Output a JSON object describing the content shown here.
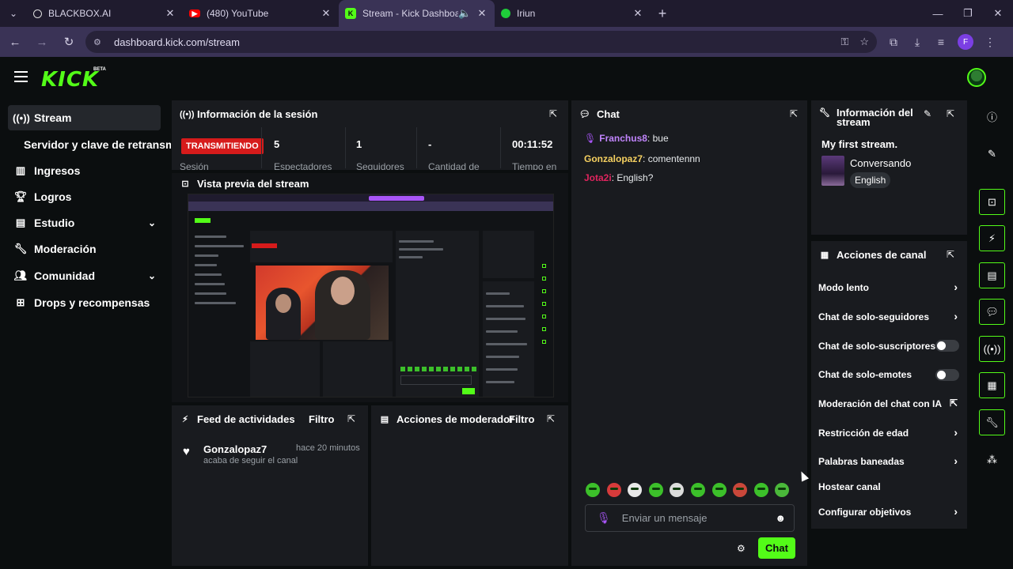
{
  "browser": {
    "tabs": [
      {
        "title": "BLACKBOX.AI",
        "favicon": "blackbox-icon"
      },
      {
        "title": "(480) YouTube",
        "favicon": "youtube-icon"
      },
      {
        "title": "Stream - Kick Dashboard",
        "favicon": "kick-icon"
      },
      {
        "title": "Iriun",
        "favicon": "iriun-icon"
      }
    ],
    "url": "dashboard.kick.com/stream",
    "profile_letter": "F"
  },
  "app": {
    "logo": "KICK",
    "logo_badge": "BETA"
  },
  "sidebar": {
    "items": [
      {
        "label": "Stream",
        "icon": "broadcast-icon"
      },
      {
        "label": "Servidor y clave de retransm"
      },
      {
        "label": "Ingresos",
        "icon": "chart-icon"
      },
      {
        "label": "Logros",
        "icon": "trophy-icon"
      },
      {
        "label": "Estudio",
        "icon": "studio-icon"
      },
      {
        "label": "Moderación",
        "icon": "wrench-icon"
      },
      {
        "label": "Comunidad",
        "icon": "users-icon"
      },
      {
        "label": "Drops y recompensas",
        "icon": "drops-icon"
      }
    ]
  },
  "session": {
    "title": "Información de la sesión",
    "status": "TRANSMITIENDO",
    "status_label": "Sesión",
    "stats": [
      {
        "value": "5",
        "label": "Espectadores"
      },
      {
        "value": "1",
        "label": "Seguidores"
      },
      {
        "value": "-",
        "label": "Cantidad de"
      },
      {
        "value": "00:11:52",
        "label": "Tiempo en"
      }
    ]
  },
  "preview": {
    "title": "Vista previa del stream"
  },
  "feed": {
    "title": "Feed de actividades",
    "filter": "Filtro",
    "items": [
      {
        "user": "Gonzalopaz7",
        "time": "hace 20 minutos",
        "action": "acaba de seguir el canal"
      }
    ]
  },
  "modactions": {
    "title": "Acciones de moderador",
    "filter": "Filtro"
  },
  "chat": {
    "title": "Chat",
    "messages": [
      {
        "user": "Franchus8",
        "text": "bue",
        "color": "#c084fc"
      },
      {
        "user": "Gonzalopaz7",
        "text": "comentennn",
        "color": "#f5d060"
      },
      {
        "user": "Jota2i",
        "text": "English?",
        "color": "#e0245e"
      }
    ],
    "input_placeholder": "Enviar un mensaje",
    "send_label": "Chat",
    "emote_count": 10
  },
  "stream_info": {
    "title": "Información del stream",
    "stream_title": "My first stream.",
    "category": "Conversando",
    "tag": "English"
  },
  "channel_actions": {
    "title": "Acciones de canal",
    "items": [
      {
        "label": "Modo lento",
        "control": "chevron"
      },
      {
        "label": "Chat de solo-seguidores",
        "control": "chevron"
      },
      {
        "label": "Chat de solo-suscriptores",
        "control": "toggle",
        "on": false
      },
      {
        "label": "Chat de solo-emotes",
        "control": "toggle",
        "on": false
      },
      {
        "label": "Moderación del chat con IA",
        "control": "external"
      },
      {
        "label": "Restricción de edad",
        "control": "chevron"
      },
      {
        "label": "Palabras baneadas",
        "control": "chevron"
      },
      {
        "label": "Hostear canal",
        "control": "none"
      },
      {
        "label": "Configurar objetivos",
        "control": "chevron"
      }
    ]
  },
  "colors": {
    "accent": "#53fc18",
    "live": "#d61b1b",
    "panel": "#191b1f",
    "background": "#0b0e0f"
  }
}
